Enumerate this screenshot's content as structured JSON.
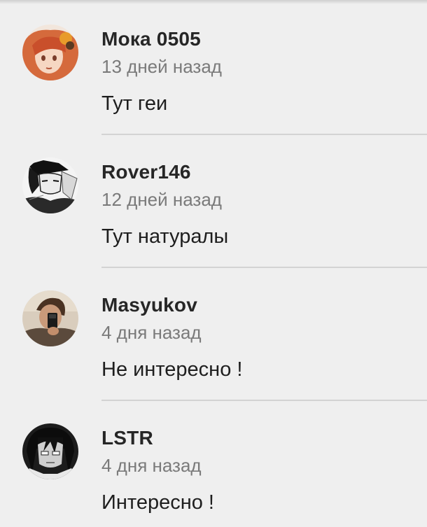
{
  "comments": [
    {
      "author": "Мока 0505",
      "time": "13 дней назад",
      "text": "Тут геи",
      "avatar_icon": "anime-girl-avatar"
    },
    {
      "author": "Rover146",
      "time": "12 дней назад",
      "text": "Тут натуралы",
      "avatar_icon": "manga-character-avatar"
    },
    {
      "author": "Masyukov",
      "time": "4 дня назад",
      "text": "Не интересно !",
      "avatar_icon": "selfie-photo-avatar"
    },
    {
      "author": "LSTR",
      "time": "4 дня назад",
      "text": "Интересно !",
      "avatar_icon": "dark-manga-avatar"
    }
  ]
}
